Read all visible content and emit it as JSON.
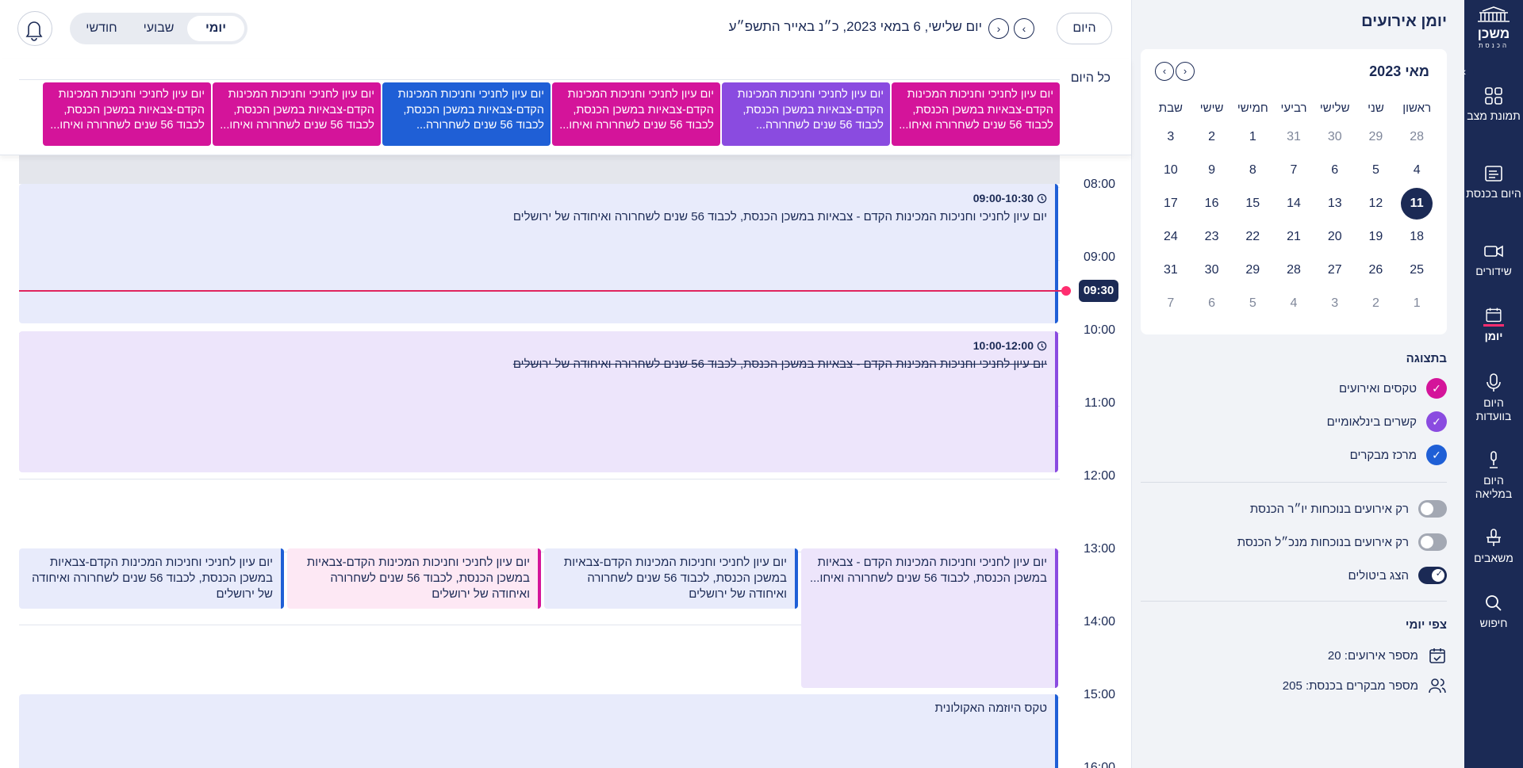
{
  "rail": {
    "logo_name": "משכן",
    "logo_sub": "הכנסת",
    "items": [
      {
        "label": "תמונת מצב",
        "icon": "dashboard-icon"
      },
      {
        "label": "היום בכנסת",
        "icon": "news-icon"
      },
      {
        "label": "שידורים",
        "icon": "video-icon"
      },
      {
        "label": "יומן",
        "icon": "calendar-icon"
      },
      {
        "label": "היום בוועדות",
        "icon": "microphone-icon"
      },
      {
        "label": "היום במליאה",
        "icon": "podium-mic-icon"
      },
      {
        "label": "משאבים",
        "icon": "resources-icon"
      },
      {
        "label": "חיפוש",
        "icon": "search-icon"
      }
    ]
  },
  "sidebar": {
    "title": "יומן אירועים",
    "mini_calendar": {
      "month_title": "מאי 2023",
      "weekdays": [
        "ראשון",
        "שני",
        "שלישי",
        "רביעי",
        "חמישי",
        "שישי",
        "שבת"
      ],
      "weeks": [
        [
          "28",
          "29",
          "30",
          "31",
          "1",
          "2",
          "3"
        ],
        [
          "4",
          "5",
          "6",
          "7",
          "8",
          "9",
          "10"
        ],
        [
          "11",
          "12",
          "13",
          "14",
          "15",
          "16",
          "17"
        ],
        [
          "18",
          "19",
          "20",
          "21",
          "22",
          "23",
          "24"
        ],
        [
          "25",
          "26",
          "27",
          "28",
          "29",
          "30",
          "31"
        ],
        [
          "1",
          "2",
          "3",
          "4",
          "5",
          "6",
          "7"
        ]
      ],
      "selected": "11"
    },
    "display_heading": "בתצוגה",
    "filters": [
      {
        "label": "טקסים ואירועים",
        "color": "#d4149a"
      },
      {
        "label": "קשרים בינלאומיים",
        "color": "#8a4be0"
      },
      {
        "label": "מרכז מבקרים",
        "color": "#1f5fd6"
      }
    ],
    "toggles": [
      {
        "label": "רק אירועים בנוכחות יו״ר הכנסת",
        "on": false
      },
      {
        "label": "רק אירועים בנוכחות מנכ״ל הכנסת",
        "on": false
      },
      {
        "label": "הצג ביטולים",
        "on": true
      }
    ],
    "forecast_heading": "צפי יומי",
    "stats": [
      {
        "label": "מספר אירועים: 20",
        "icon": "calendar-check-icon"
      },
      {
        "label": "מספר מבקרים בכנסת: 205",
        "icon": "people-icon"
      }
    ]
  },
  "topbar": {
    "today_label": "היום",
    "date_title": "יום שלישי, 6 במאי 2023, כ״נ באייר התשפ״ע",
    "views": [
      "יומי",
      "שבועי",
      "חודשי"
    ],
    "active_view": "יומי"
  },
  "allday": {
    "label": "כל היום",
    "chips": [
      {
        "text": "יום עיון לחניכי וחניכות המכינות הקדם-צבאיות במשכן הכנסת, לכבוד 56 שנים לשחרורה ואיחו...",
        "color": "#d4149a"
      },
      {
        "text": "יום עיון לחניכי וחניכות המכינות הקדם-צבאיות במשכן הכנסת, לכבוד 56 שנים לשחרורה...",
        "color": "#8a4be0"
      },
      {
        "text": "יום עיון לחניכי וחניכות המכינות הקדם-צבאיות במשכן הכנסת, לכבוד 56 שנים לשחרורה ואיחו...",
        "color": "#d4149a"
      },
      {
        "text": "יום עיון לחניכי וחניכות המכינות הקדם-צבאיות במשכן הכנסת, לכבוד 56 שנים לשחרורה...",
        "color": "#1f5fd6"
      },
      {
        "text": "יום עיון לחניכי וחניכות המכינות הקדם-צבאיות במשכן הכנסת, לכבוד 56 שנים לשחרורה ואיחו...",
        "color": "#d4149a"
      },
      {
        "text": "יום עיון לחניכי וחניכות המכינות הקדם-צבאיות במשכן הכנסת, לכבוד 56 שנים לשחרורה ואיחו...",
        "color": "#d4149a"
      }
    ]
  },
  "timeline": {
    "hours": [
      "08:00",
      "09:00",
      "10:00",
      "11:00",
      "12:00",
      "13:00",
      "14:00",
      "15:00",
      "16:00"
    ],
    "now_label": "09:30",
    "events": [
      {
        "time": "09:00-10:30",
        "title": "יום עיון לחניכי וחניכות המכינות הקדם - צבאיות במשכן הכנסת, לכבוד 56 שנים לשחרורה ואיחודה של ירושלים",
        "bg": "#e8ebfb",
        "bar": "#1f5fd6",
        "cancelled": false
      },
      {
        "time": "10:00-12:00",
        "title": "יום עיון לחניכי וחניכות המכינות הקדם - צבאיות במשכן הכנסת, לכבוד 56 שנים לשחרורה ואיחודה של ירושלים",
        "bg": "#ede5fb",
        "bar": "#8a4be0",
        "cancelled": true
      },
      {
        "time": "",
        "title": "יום עיון לחניכי וחניכות המכינות הקדם - צבאיות במשכן הכנסת, לכבוד 56 שנים לשחרורה ואיחו...",
        "bg": "#ede5fb",
        "bar": "#8a4be0",
        "cancelled": false
      },
      {
        "time": "",
        "title": "יום עיון לחניכי וחניכות המכינות הקדם-צבאיות במשכן הכנסת, לכבוד 56 שנים לשחרורה ואיחודה של ירושלים",
        "bg": "#e8ebfb",
        "bar": "#1f5fd6",
        "cancelled": false
      },
      {
        "time": "",
        "title": "יום עיון לחניכי וחניכות המכינות הקדם-צבאיות במשכן הכנסת, לכבוד 56 שנים לשחרורה ואיחודה של ירושלים",
        "bg": "#fde8f4",
        "bar": "#d4149a",
        "cancelled": false
      },
      {
        "time": "",
        "title": "יום עיון לחניכי וחניכות המכינות הקדם-צבאיות במשכן הכנסת, לכבוד 56 שנים לשחרורה ואיחודה של ירושלים",
        "bg": "#e8ebfb",
        "bar": "#1f5fd6",
        "cancelled": false
      },
      {
        "time": "",
        "title": "טקס היוזמה האקולונית",
        "bg": "#e8ebfb",
        "bar": "#1f5fd6",
        "cancelled": false
      }
    ]
  }
}
